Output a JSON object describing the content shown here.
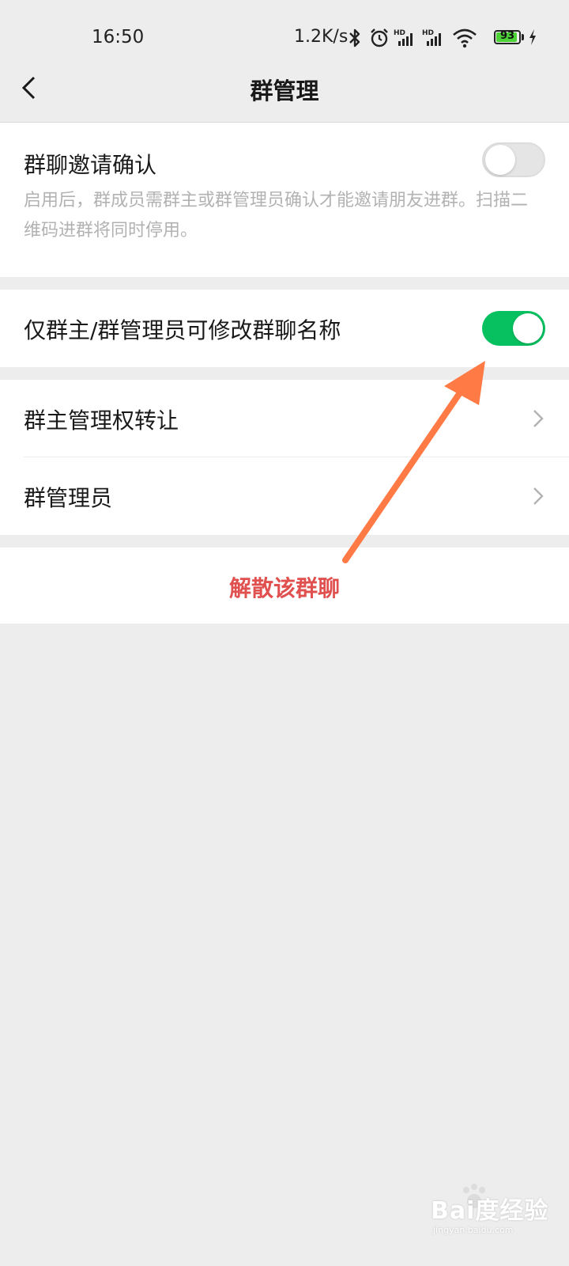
{
  "status_bar": {
    "time": "16:50",
    "network_speed": "1.2K/s",
    "battery_level": "93",
    "icons": [
      "bluetooth-icon",
      "alarm-icon",
      "hd-signal-icon",
      "hd-signal-icon",
      "wifi-icon",
      "battery-icon",
      "charging-icon"
    ]
  },
  "nav": {
    "title": "群管理",
    "back_icon": "chevron-left-icon"
  },
  "invite_confirm": {
    "title": "群聊邀请确认",
    "description": "启用后，群成员需群主或群管理员确认才能邀请朋友进群。扫描二维码进群将同时停用。",
    "enabled": false
  },
  "rename_restriction": {
    "title": "仅群主/群管理员可修改群聊名称",
    "enabled": true
  },
  "menu": {
    "transfer_owner": "群主管理权转让",
    "admins": "群管理员"
  },
  "dissolve": {
    "label": "解散该群聊"
  },
  "watermark": {
    "text": "Bai度经验",
    "sub": "jingyan.baidu.com"
  },
  "colors": {
    "accent_green": "#07c160",
    "danger_red": "#e0504f",
    "annotation_orange": "#ff7a45",
    "background": "#ededed"
  }
}
